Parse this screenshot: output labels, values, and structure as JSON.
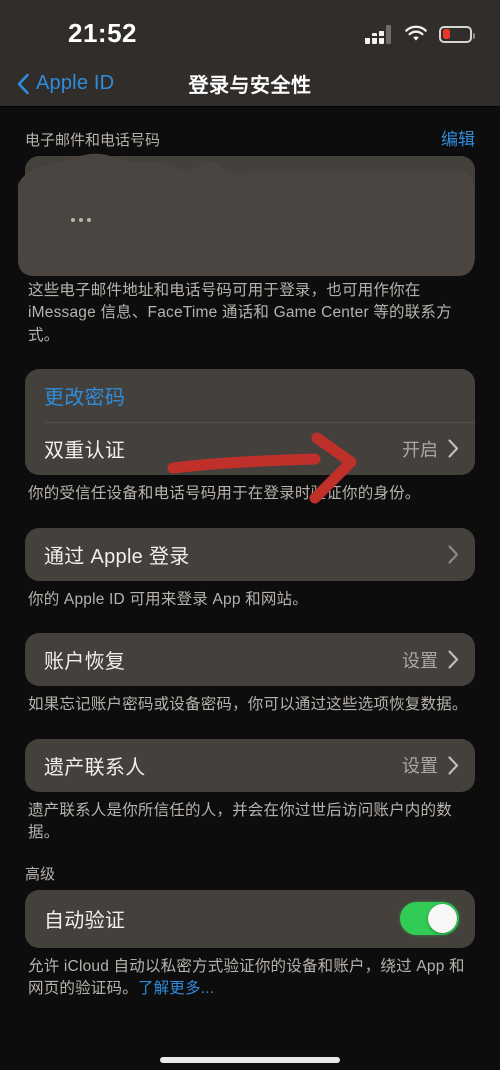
{
  "status_bar": {
    "time": "21:52",
    "signal_icon": "cellular-signal-icon",
    "wifi_icon": "wifi-icon",
    "battery_icon": "battery-low-icon",
    "battery_color": "#e8362c"
  },
  "nav": {
    "back_icon": "chevron-left-icon",
    "back_label": "Apple ID",
    "title": "登录与安全性",
    "accent_color": "#2f8cdd"
  },
  "sections": {
    "email_phone": {
      "header": "电子邮件和电话号码",
      "edit_label": "编辑",
      "redacted": true,
      "footer": "这些电子邮件地址和电话号码可用于登录，也可用作你在 iMessage 信息、FaceTime 通话和 Game Center 等的联系方式。"
    },
    "security": {
      "change_password_label": "更改密码",
      "two_factor_label": "双重认证",
      "two_factor_value": "开启",
      "footer": "你的受信任设备和电话号码用于在登录时验证你的身份。"
    },
    "sign_in_with_apple": {
      "label": "通过 Apple 登录",
      "footer": "你的 Apple ID 可用来登录 App 和网站。"
    },
    "account_recovery": {
      "label": "账户恢复",
      "value": "设置",
      "footer": "如果忘记账户密码或设备密码，你可以通过这些选项恢复数据。"
    },
    "legacy_contact": {
      "label": "遗产联系人",
      "value": "设置",
      "footer": "遗产联系人是你所信任的人，并会在你过世后访问账户内的数据。"
    },
    "advanced": {
      "header": "高级",
      "auto_verify_label": "自动验证",
      "auto_verify_on": true,
      "toggle_color": "#32cb56",
      "footer_text": "允许 iCloud 自动以私密方式验证你的设备和账户，绕过 App 和网页的验证码。",
      "footer_link": "了解更多..."
    }
  },
  "annotation": {
    "arrow_icon": "red-arrow-right-annotation",
    "color": "#c0302b"
  },
  "home_indicator": "home-indicator"
}
